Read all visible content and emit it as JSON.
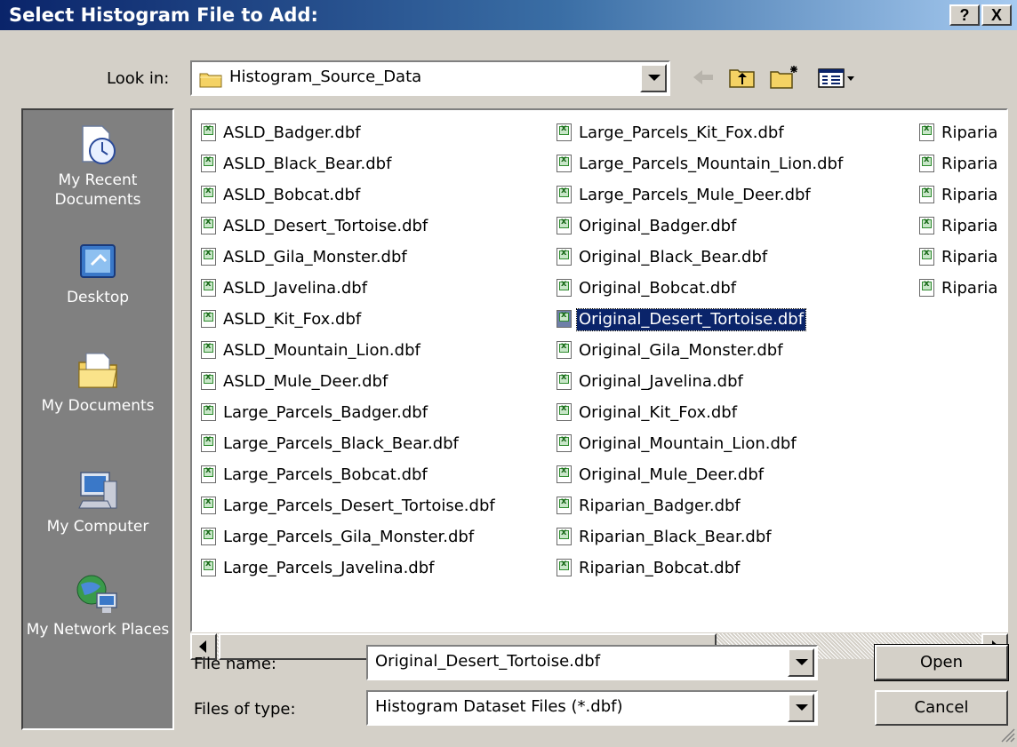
{
  "window": {
    "title": "Select Histogram File to Add:",
    "help_label": "?",
    "close_label": "X"
  },
  "look_in": {
    "label": "Look in:",
    "value": "Histogram_Source_Data"
  },
  "places": [
    {
      "label": "My Recent Documents",
      "icon": "recent-documents-icon"
    },
    {
      "label": "Desktop",
      "icon": "desktop-icon"
    },
    {
      "label": "My Documents",
      "icon": "my-documents-icon"
    },
    {
      "label": "My Computer",
      "icon": "my-computer-icon"
    },
    {
      "label": "My Network Places",
      "icon": "network-places-icon"
    }
  ],
  "files": {
    "col1": [
      "ASLD_Badger.dbf",
      "ASLD_Black_Bear.dbf",
      "ASLD_Bobcat.dbf",
      "ASLD_Desert_Tortoise.dbf",
      "ASLD_Gila_Monster.dbf",
      "ASLD_Javelina.dbf",
      "ASLD_Kit_Fox.dbf",
      "ASLD_Mountain_Lion.dbf",
      "ASLD_Mule_Deer.dbf",
      "Large_Parcels_Badger.dbf",
      "Large_Parcels_Black_Bear.dbf",
      "Large_Parcels_Bobcat.dbf",
      "Large_Parcels_Desert_Tortoise.dbf",
      "Large_Parcels_Gila_Monster.dbf",
      "Large_Parcels_Javelina.dbf"
    ],
    "col2": [
      "Large_Parcels_Kit_Fox.dbf",
      "Large_Parcels_Mountain_Lion.dbf",
      "Large_Parcels_Mule_Deer.dbf",
      "Original_Badger.dbf",
      "Original_Black_Bear.dbf",
      "Original_Bobcat.dbf",
      "Original_Desert_Tortoise.dbf",
      "Original_Gila_Monster.dbf",
      "Original_Javelina.dbf",
      "Original_Kit_Fox.dbf",
      "Original_Mountain_Lion.dbf",
      "Original_Mule_Deer.dbf",
      "Riparian_Badger.dbf",
      "Riparian_Black_Bear.dbf",
      "Riparian_Bobcat.dbf"
    ],
    "col3": [
      "Riparia",
      "Riparia",
      "Riparia",
      "Riparia",
      "Riparia",
      "Riparia"
    ],
    "selected": "Original_Desert_Tortoise.dbf"
  },
  "file_name": {
    "label": "File name:",
    "value": "Original_Desert_Tortoise.dbf"
  },
  "file_type": {
    "label": "Files of type:",
    "value": "Histogram Dataset Files (*.dbf)"
  },
  "buttons": {
    "open": "Open",
    "cancel": "Cancel"
  },
  "colors": {
    "titlebar_start": "#0a246a",
    "titlebar_end": "#a6caf0",
    "selection": "#0a246a",
    "dialog_bg": "#d4d0c8"
  }
}
